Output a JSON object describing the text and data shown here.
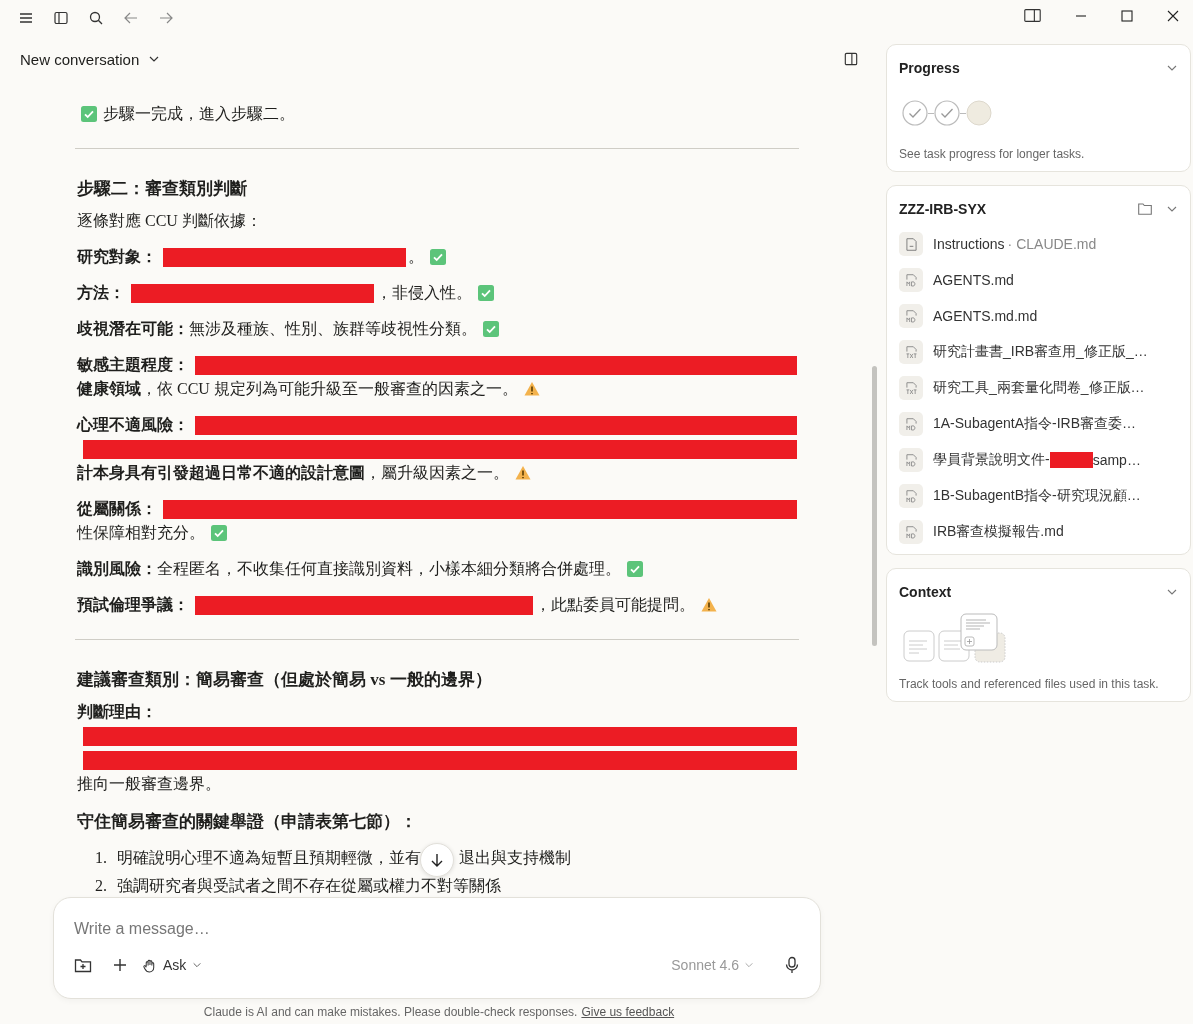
{
  "conversation": {
    "title": "New conversation"
  },
  "message": {
    "blocks": [
      {
        "kind": "para",
        "lines": [
          [
            {
              "kind": "check"
            },
            {
              "kind": "text",
              "text": "步驟一完成，進入步驟二。"
            }
          ]
        ]
      },
      {
        "kind": "rule"
      },
      {
        "kind": "heading",
        "text": "步驟二：審查類別判斷"
      },
      {
        "kind": "para",
        "lines": [
          [
            {
              "kind": "text",
              "text": "逐條對應 CCU 判斷依據："
            }
          ]
        ]
      },
      {
        "kind": "para",
        "lines": [
          [
            {
              "kind": "bold",
              "text": "研究對象："
            },
            {
              "kind": "short-redaction"
            },
            {
              "kind": "text",
              "text": "。"
            },
            {
              "kind": "check"
            }
          ]
        ]
      },
      {
        "kind": "para",
        "lines": [
          [
            {
              "kind": "bold",
              "text": "方法："
            },
            {
              "kind": "short-redaction"
            },
            {
              "kind": "text",
              "text": "，非侵入性。"
            },
            {
              "kind": "check"
            }
          ]
        ]
      },
      {
        "kind": "para",
        "lines": [
          [
            {
              "kind": "bold",
              "text": "歧視潛在可能："
            },
            {
              "kind": "text",
              "text": "無涉及種族、性別、族群等歧視性分類。"
            },
            {
              "kind": "check"
            }
          ]
        ]
      },
      {
        "kind": "para",
        "lines": [
          [
            {
              "kind": "bold",
              "text": "敏感主題程度："
            },
            {
              "kind": "redaction"
            }
          ],
          [
            {
              "kind": "bold",
              "text": "健康領域"
            },
            {
              "kind": "text",
              "text": "，依 CCU 規定列為可能升級至一般審查的因素之一。"
            },
            {
              "kind": "warn"
            }
          ]
        ]
      },
      {
        "kind": "para",
        "lines": [
          [
            {
              "kind": "bold",
              "text": "心理不適風險："
            },
            {
              "kind": "redaction"
            }
          ],
          [
            {
              "kind": "redaction"
            }
          ],
          [
            {
              "kind": "bold",
              "text": "計本身具有引發超過日常不適的設計意圖"
            },
            {
              "kind": "text",
              "text": "，屬升級因素之一。"
            },
            {
              "kind": "warn"
            }
          ]
        ]
      },
      {
        "kind": "para",
        "lines": [
          [
            {
              "kind": "bold",
              "text": "從屬關係："
            },
            {
              "kind": "redaction"
            }
          ],
          [
            {
              "kind": "text",
              "text": "性保障相對充分。"
            },
            {
              "kind": "check"
            }
          ]
        ]
      },
      {
        "kind": "para",
        "lines": [
          [
            {
              "kind": "bold",
              "text": "識別風險："
            },
            {
              "kind": "text",
              "text": "全程匿名，不收集任何直接識別資料，小樣本細分類將合併處理。"
            },
            {
              "kind": "check"
            }
          ]
        ]
      },
      {
        "kind": "para",
        "lines": [
          [
            {
              "kind": "bold",
              "text": "預試倫理爭議："
            },
            {
              "kind": "long-redaction"
            },
            {
              "kind": "text",
              "text": "，此點委員可能提問。"
            },
            {
              "kind": "warn"
            }
          ]
        ]
      },
      {
        "kind": "rule"
      },
      {
        "kind": "heading",
        "text": "建議審查類別：簡易審查（但處於簡易 vs 一般的邊界）"
      },
      {
        "kind": "para",
        "lines": [
          [
            {
              "kind": "bold",
              "text": "判斷理由："
            }
          ],
          [
            {
              "kind": "redaction"
            }
          ],
          [
            {
              "kind": "redaction"
            }
          ],
          [
            {
              "kind": "text",
              "text": "推向一般審查邊界。"
            }
          ]
        ]
      },
      {
        "kind": "heading",
        "text": "守住簡易審查的關鍵舉證（申請表第七節）："
      },
      {
        "kind": "list",
        "items": [
          {
            "number": "1.",
            "parts": [
              {
                "kind": "text",
                "text": "明確說明心理不適為短暫且預期輕微，並有"
              },
              {
                "kind": "hidden"
              },
              {
                "kind": "text",
                "text": "退出與支持機制"
              }
            ]
          },
          {
            "number": "2.",
            "parts": [
              {
                "kind": "text",
                "text": "強調研究者與受試者之間不存在從屬或權力不對等關係"
              }
            ]
          }
        ]
      }
    ]
  },
  "composer": {
    "placeholder": "Write a message…",
    "mode": "Ask",
    "model": "Sonnet 4.6"
  },
  "disclaimer": {
    "text": "Claude is AI and can make mistakes. Please double-check responses.",
    "link": "Give us feedback"
  },
  "progress": {
    "title": "Progress",
    "steps": [
      {
        "done": true
      },
      {
        "done": true
      },
      {
        "done": false
      }
    ],
    "note": "See task progress for longer tasks."
  },
  "folder": {
    "title": "ZZZ-IRB-SYX",
    "files": [
      {
        "kind": "doc",
        "name": "Instructions",
        "detail": "· CLAUDE.md"
      },
      {
        "kind": "md",
        "name": "AGENTS.md"
      },
      {
        "kind": "md",
        "name": "AGENTS.md.md"
      },
      {
        "kind": "txt",
        "name": "研究計畫書_IRB審查用_修正版_…"
      },
      {
        "kind": "txt",
        "name": "研究工具_兩套量化問卷_修正版…"
      },
      {
        "kind": "md",
        "name": "1A-SubagentA指令-IRB審查委…"
      },
      {
        "kind": "md",
        "name": "學員背景說明文件-",
        "redacted": true,
        "tail": "samp…"
      },
      {
        "kind": "md",
        "name": "1B-SubagentB指令-研究現況顧…"
      },
      {
        "kind": "md",
        "name": "IRB審查模擬報告.md"
      }
    ]
  },
  "context": {
    "title": "Context",
    "note": "Track tools and referenced files used in this task."
  }
}
